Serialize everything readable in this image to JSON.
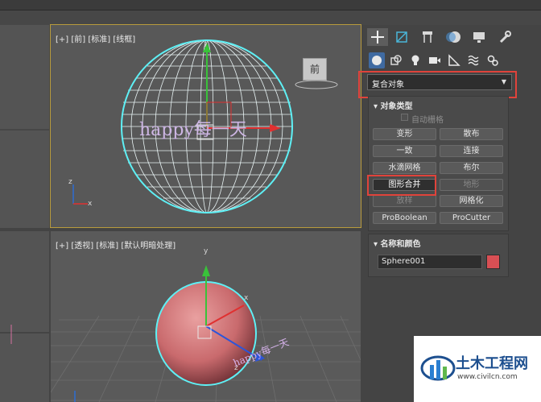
{
  "viewports": {
    "front_label": "[+] [前] [标准] [线框]",
    "persp_label": "[+] [透视] [标准] [默认明暗处理]",
    "viewcube_label": "前",
    "front_text": "happy每一天",
    "persp_text": "happy每一天",
    "axis_x": "x",
    "axis_y": "y",
    "axis_z": "z"
  },
  "panel": {
    "tabs": [
      "create-icon",
      "modify-icon",
      "hierarchy-icon",
      "motion-icon",
      "display-icon",
      "utilities-icon"
    ],
    "categories": [
      "geometry-icon",
      "shapes-icon",
      "lights-icon",
      "cameras-icon",
      "helpers-icon",
      "spacewarps-icon",
      "systems-icon"
    ],
    "dropdown_value": "复合对象",
    "object_type": {
      "title": "对象类型",
      "autogrid_label": "自动栅格",
      "buttons": [
        "变形",
        "散布",
        "一致",
        "连接",
        "水滴网格",
        "布尔",
        "图形合并",
        "地形",
        "放样",
        "网格化",
        "ProBoolean",
        "ProCutter"
      ]
    },
    "name_color": {
      "title": "名称和颜色",
      "name_value": "Sphere001",
      "color": "#d84f54"
    }
  },
  "watermark": {
    "title": "土木工程网",
    "url": "www.civilcn.com"
  }
}
